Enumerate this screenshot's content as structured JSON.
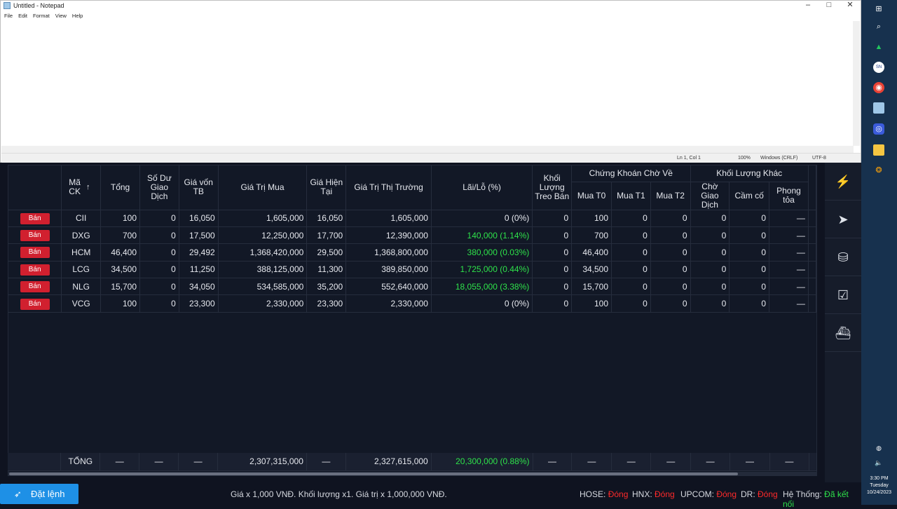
{
  "notepad": {
    "title": "Untitled - Notepad",
    "menu": [
      "File",
      "Edit",
      "Format",
      "View",
      "Help"
    ],
    "status": {
      "position": "Ln 1, Col 1",
      "zoom": "100%",
      "line_ending": "Windows (CRLF)",
      "encoding": "UTF-8"
    }
  },
  "taskbar": {
    "time": "3:30 PM",
    "day": "Tuesday",
    "date": "10/24/2023"
  },
  "table": {
    "headers": {
      "ma": "Mã\nCK",
      "tong": "Tổng",
      "so_du": "Số Dư\nGiao\nDịch",
      "gia_von": "Giá vốn\nTB",
      "gia_tri_mua": "Giá Trị Mua",
      "gia_hien_tai": "Giá Hiện\nTại",
      "gia_tri_thi_truong": "Giá Trị Thị Trường",
      "lai_lo": "Lãi/Lỗ (%)",
      "khoi_luong_treo": "Khối\nLượng\nTreo Bán",
      "group_cho_ve": "Chứng Khoán Chờ Về",
      "mua_t0": "Mua T0",
      "mua_t1": "Mua T1",
      "mua_t2": "Mua T2",
      "group_khac": "Khối Lượng Khác",
      "cho_giao_dich": "Chờ Giao\nDịch",
      "cam_co": "Cầm cố",
      "phong_toa": "Phong\ntỏa"
    },
    "sell_label": "Bán",
    "rows": [
      {
        "ma": "CII",
        "tong": "100",
        "so_du": "0",
        "gia_von": "16,050",
        "gia_tri_mua": "1,605,000",
        "gia_hien_tai": "16,050",
        "gia_tri_tt": "1,605,000",
        "lai_lo": "0 (0%)",
        "positive": false,
        "treo": "0",
        "t0": "100",
        "t1": "0",
        "t2": "0",
        "cho_gd": "0",
        "cam_co": "0",
        "phong_toa": "—"
      },
      {
        "ma": "DXG",
        "tong": "700",
        "so_du": "0",
        "gia_von": "17,500",
        "gia_tri_mua": "12,250,000",
        "gia_hien_tai": "17,700",
        "gia_tri_tt": "12,390,000",
        "lai_lo": "140,000 (1.14%)",
        "positive": true,
        "treo": "0",
        "t0": "700",
        "t1": "0",
        "t2": "0",
        "cho_gd": "0",
        "cam_co": "0",
        "phong_toa": "—"
      },
      {
        "ma": "HCM",
        "tong": "46,400",
        "so_du": "0",
        "gia_von": "29,492",
        "gia_tri_mua": "1,368,420,000",
        "gia_hien_tai": "29,500",
        "gia_tri_tt": "1,368,800,000",
        "lai_lo": "380,000 (0.03%)",
        "positive": true,
        "treo": "0",
        "t0": "46,400",
        "t1": "0",
        "t2": "0",
        "cho_gd": "0",
        "cam_co": "0",
        "phong_toa": "—"
      },
      {
        "ma": "LCG",
        "tong": "34,500",
        "so_du": "0",
        "gia_von": "11,250",
        "gia_tri_mua": "388,125,000",
        "gia_hien_tai": "11,300",
        "gia_tri_tt": "389,850,000",
        "lai_lo": "1,725,000 (0.44%)",
        "positive": true,
        "treo": "0",
        "t0": "34,500",
        "t1": "0",
        "t2": "0",
        "cho_gd": "0",
        "cam_co": "0",
        "phong_toa": "—"
      },
      {
        "ma": "NLG",
        "tong": "15,700",
        "so_du": "0",
        "gia_von": "34,050",
        "gia_tri_mua": "534,585,000",
        "gia_hien_tai": "35,200",
        "gia_tri_tt": "552,640,000",
        "lai_lo": "18,055,000 (3.38%)",
        "positive": true,
        "treo": "0",
        "t0": "15,700",
        "t1": "0",
        "t2": "0",
        "cho_gd": "0",
        "cam_co": "0",
        "phong_toa": "—"
      },
      {
        "ma": "VCG",
        "tong": "100",
        "so_du": "0",
        "gia_von": "23,300",
        "gia_tri_mua": "2,330,000",
        "gia_hien_tai": "23,300",
        "gia_tri_tt": "2,330,000",
        "lai_lo": "0 (0%)",
        "positive": false,
        "treo": "0",
        "t0": "100",
        "t1": "0",
        "t2": "0",
        "cho_gd": "0",
        "cam_co": "0",
        "phong_toa": "—"
      }
    ],
    "totals": {
      "label": "TỔNG",
      "dash": "—",
      "gia_tri_mua": "2,307,315,000",
      "gia_tri_tt": "2,327,615,000",
      "lai_lo": "20,300,000 (0.88%)"
    }
  },
  "bottom": {
    "order_button": "Đặt lệnh",
    "note": "Giá x 1,000 VNĐ. Khối lượng x1. Giá trị x 1,000,000 VNĐ.",
    "markets": [
      {
        "name": "HOSE:",
        "status": "Đóng"
      },
      {
        "name": "HNX:",
        "status": "Đóng"
      },
      {
        "name": "UPCOM:",
        "status": "Đóng"
      },
      {
        "name": "DR:",
        "status": "Đóng"
      }
    ],
    "system_label": "Hệ Thống:",
    "system_status": "Đã kết nối"
  },
  "colors": {
    "sell": "#d1202f",
    "positive": "#2ee24a",
    "closed": "#ff2a2a",
    "order_button": "#1e90e6"
  }
}
